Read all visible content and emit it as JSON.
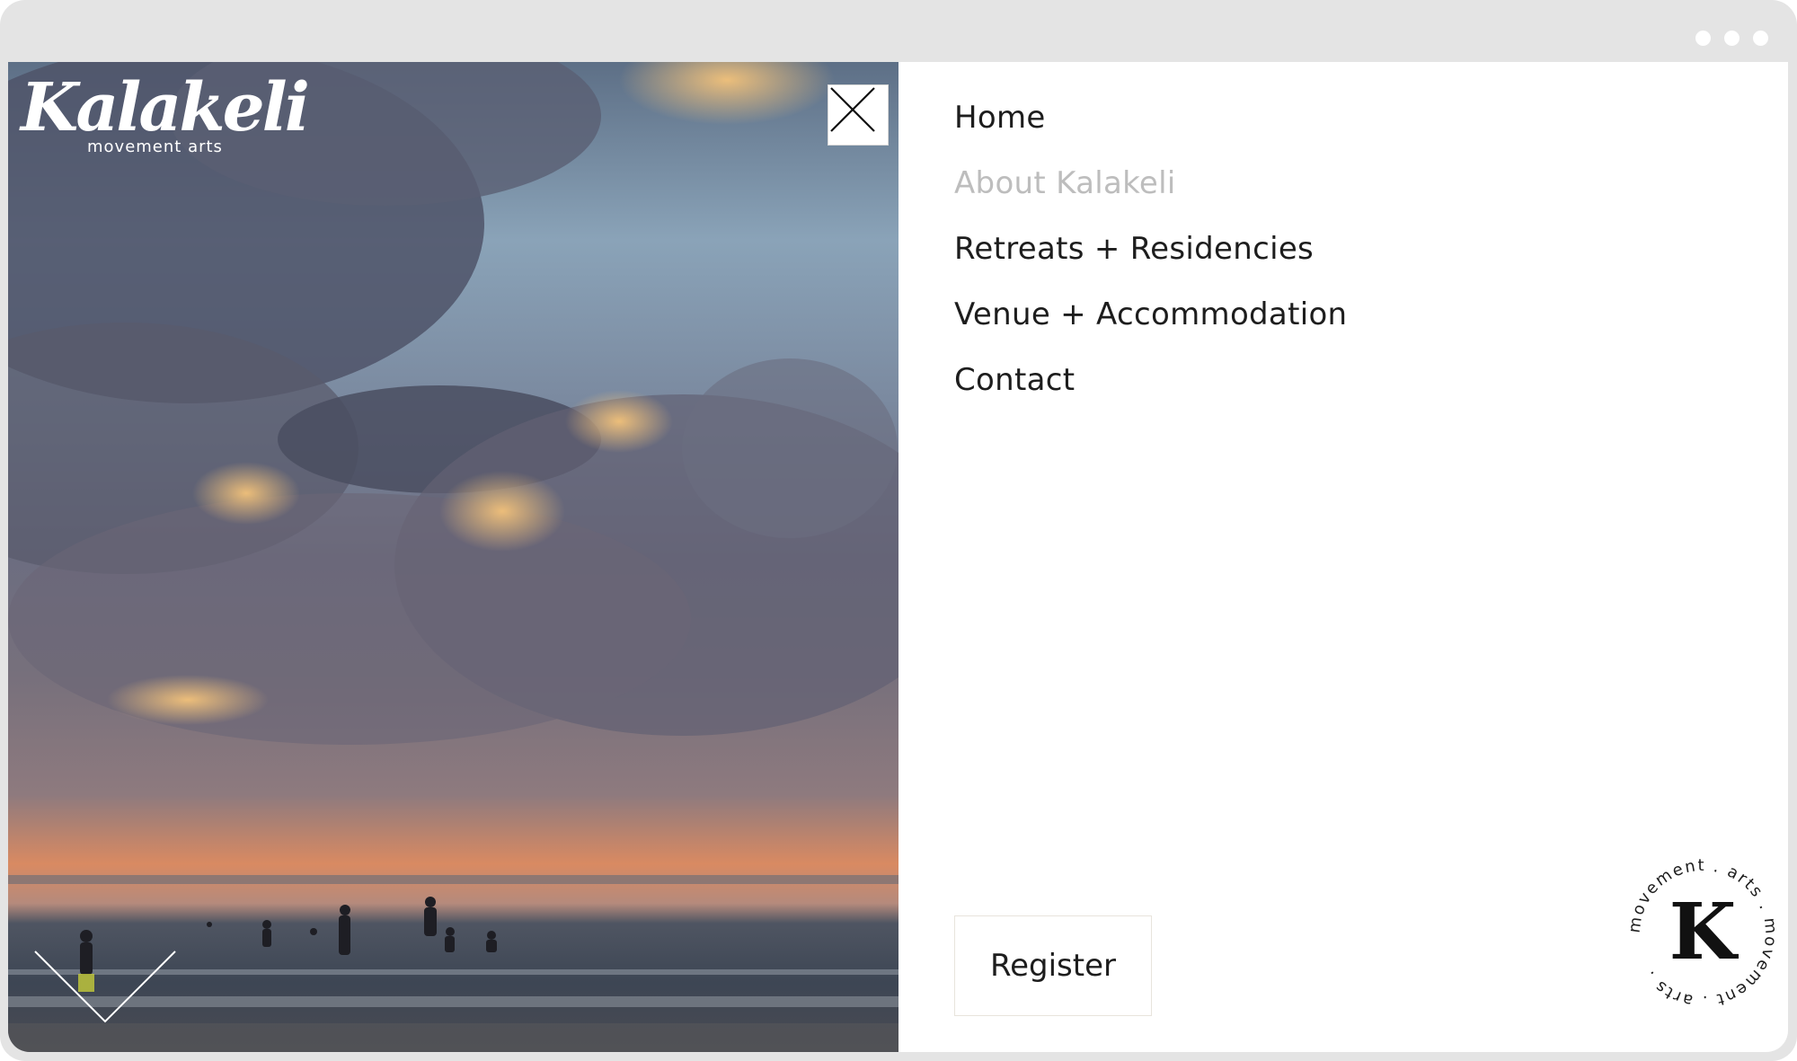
{
  "browser": {
    "dots": [
      "window-dot",
      "window-dot",
      "window-dot"
    ]
  },
  "brand": {
    "name": "Kalakeli",
    "tagline": "movement arts"
  },
  "hero": {
    "icons": {
      "close": "close-icon",
      "scroll": "chevron-down-icon"
    }
  },
  "nav": {
    "items": [
      {
        "label": "Home",
        "state": "default"
      },
      {
        "label": "About Kalakeli",
        "state": "current"
      },
      {
        "label": "Retreats + Residencies",
        "state": "default"
      },
      {
        "label": "Venue + Accommodation",
        "state": "default"
      },
      {
        "label": "Contact",
        "state": "default"
      }
    ],
    "register_label": "Register"
  },
  "badge": {
    "ring_text": "movement . arts . movement . arts .",
    "letter": "K"
  },
  "colors": {
    "frame": "#e4e4e4",
    "text": "#1d1d1d",
    "muted": "#bdbdbd",
    "sunset": "#d98a62"
  }
}
